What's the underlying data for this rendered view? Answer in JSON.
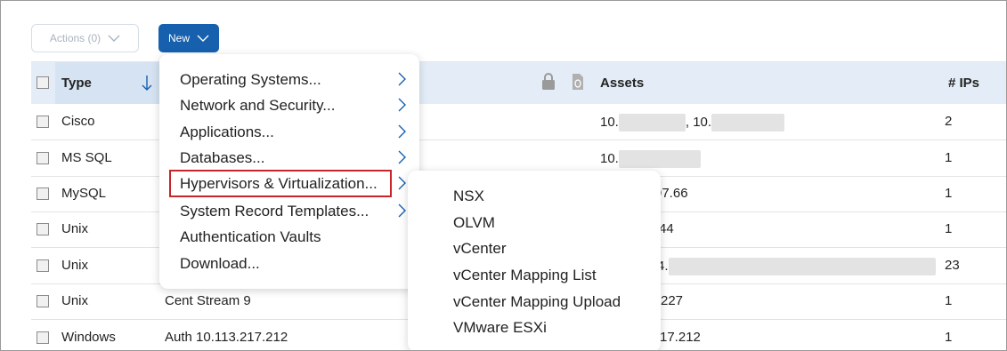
{
  "toolbar": {
    "actions_label": "Actions (0)",
    "new_label": "New"
  },
  "table": {
    "headers": {
      "type": "Type",
      "assets": "Assets",
      "ips": "# IPs"
    },
    "rows": [
      {
        "type": "Cisco",
        "name": "",
        "assets_prefix": "10.",
        "assets_mid": ", 10.",
        "assets_suffix": "",
        "ips": "2"
      },
      {
        "type": "MS SQL",
        "name": "",
        "assets_prefix": "10.",
        "assets_mid": "",
        "assets_suffix": "",
        "ips": "1"
      },
      {
        "type": "MySQL",
        "name": "",
        "assets_prefix": "",
        "assets_mid": "",
        "assets_suffix": "97.66",
        "ips": "1"
      },
      {
        "type": "Unix",
        "name": "",
        "assets_prefix": "",
        "assets_mid": "",
        "assets_suffix": "44",
        "ips": "1"
      },
      {
        "type": "Unix",
        "name": "",
        "assets_prefix": "",
        "assets_mid": "",
        "assets_suffix": "4.",
        "ips": "23"
      },
      {
        "type": "Unix",
        "name": "Cent Stream 9",
        "assets_prefix": "",
        "assets_mid": "",
        "assets_suffix": "227",
        "ips": "1"
      },
      {
        "type": "Windows",
        "name": "Auth 10.113.217.212",
        "assets_prefix": "",
        "assets_mid": "",
        "assets_suffix": "17.212",
        "ips": "1"
      }
    ]
  },
  "new_menu": {
    "items": [
      {
        "label": "Operating Systems...",
        "has_submenu": true
      },
      {
        "label": "Network and Security...",
        "has_submenu": true
      },
      {
        "label": "Applications...",
        "has_submenu": true
      },
      {
        "label": "Databases...",
        "has_submenu": true
      },
      {
        "label": "Hypervisors & Virtualization...",
        "has_submenu": true,
        "highlighted": true
      },
      {
        "label": "System Record Templates...",
        "has_submenu": true
      },
      {
        "label": "Authentication Vaults",
        "has_submenu": false
      },
      {
        "label": "Download...",
        "has_submenu": false
      }
    ]
  },
  "submenu": {
    "items": [
      "NSX",
      "OLVM",
      "vCenter",
      "vCenter Mapping List",
      "vCenter Mapping Upload",
      "VMware ESXi"
    ]
  },
  "colors": {
    "accent": "#1660ad",
    "highlight_border": "#c8242b",
    "header_bg": "#e4edf7"
  },
  "icons": [
    "chevron-down-icon",
    "sort-down-arrow-icon",
    "lock-icon",
    "document-icon",
    "chevron-right-icon"
  ]
}
